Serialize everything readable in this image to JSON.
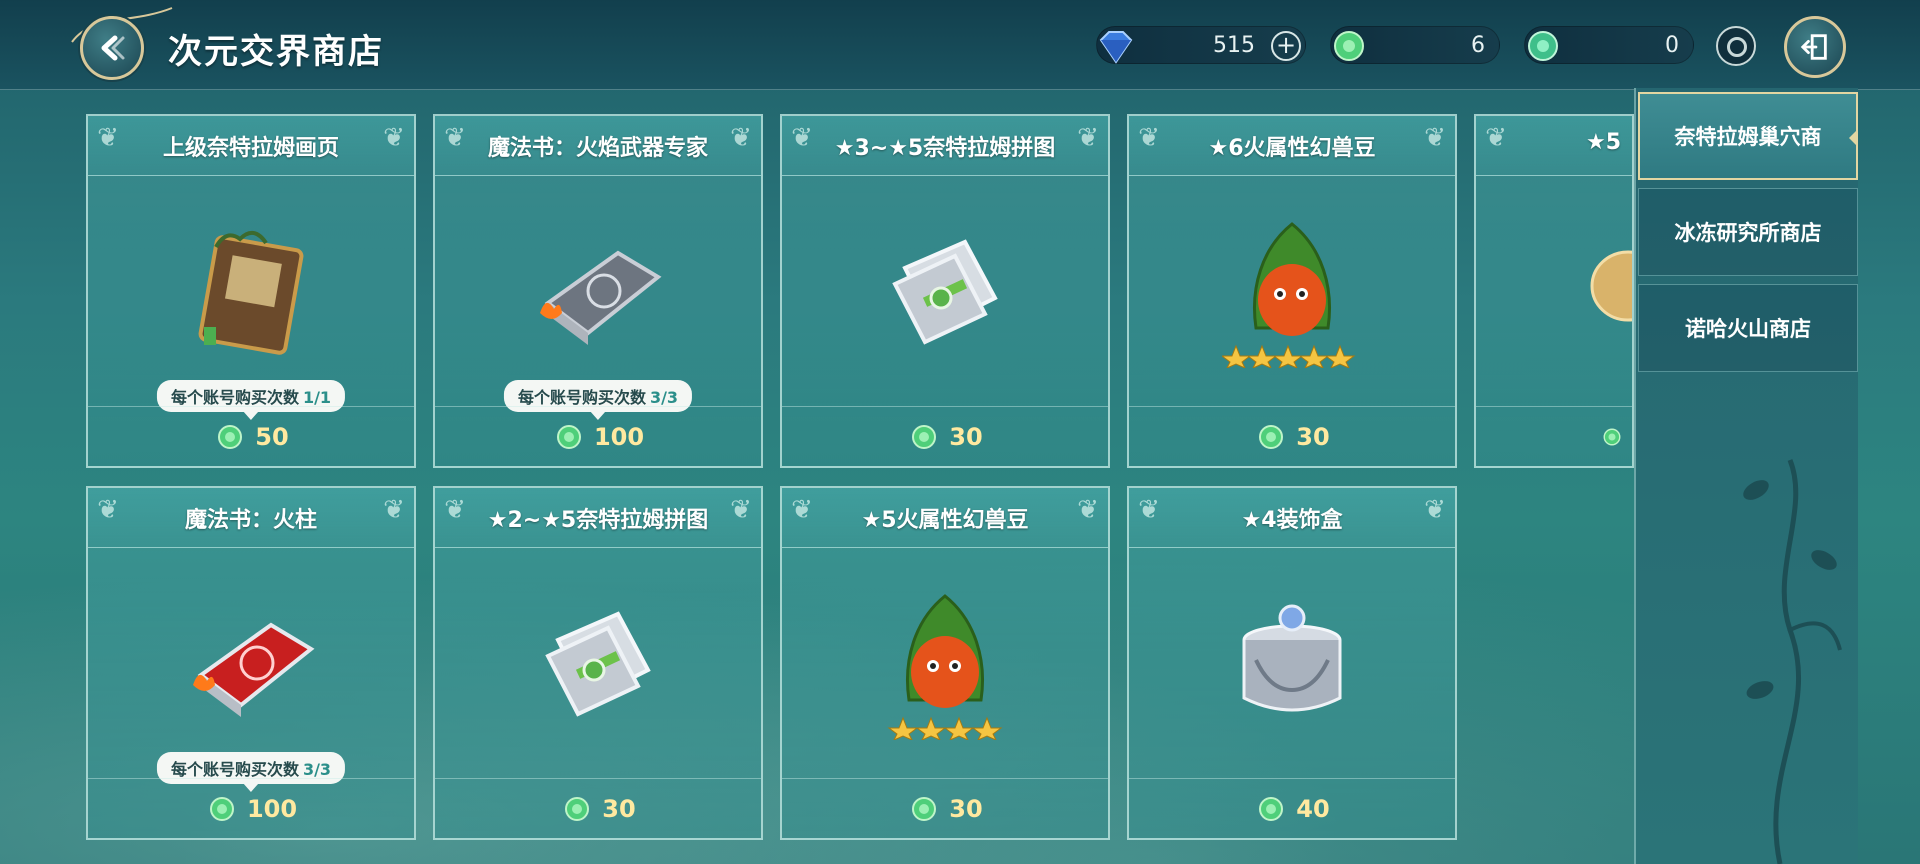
{
  "header": {
    "title": "次元交界商店",
    "resources": [
      {
        "icon": "blue-diamond-icon",
        "value": "515",
        "has_plus": true
      },
      {
        "icon": "green-crystal-icon",
        "value": "6"
      },
      {
        "icon": "green-crystal-icon",
        "value": "0"
      }
    ]
  },
  "shop_items": [
    {
      "name": "上级奈特拉姆画页",
      "price": "50",
      "limit_label": "每个账号购买次数",
      "limit_count": "1/1",
      "art": "brown-book"
    },
    {
      "name": "魔法书：火焰武器专家",
      "price": "100",
      "limit_label": "每个账号购买次数",
      "limit_count": "3/3",
      "art": "gray-book"
    },
    {
      "name": "★3~★5奈特拉姆拼图",
      "price": "30",
      "art": "pack"
    },
    {
      "name": "★6火属性幻兽豆",
      "price": "30",
      "art": "bean6"
    },
    {
      "name": "★5",
      "price": "",
      "art": "partial"
    },
    {
      "name": "魔法书：火柱",
      "price": "100",
      "limit_label": "每个账号购买次数",
      "limit_count": "3/3",
      "art": "red-book"
    },
    {
      "name": "★2~★5奈特拉姆拼图",
      "price": "30",
      "art": "pack"
    },
    {
      "name": "★5火属性幻兽豆",
      "price": "30",
      "art": "bean5"
    },
    {
      "name": "★4装饰盒",
      "price": "40",
      "art": "box"
    }
  ],
  "side_tabs": [
    {
      "label": "奈特拉姆巢穴商",
      "active": true
    },
    {
      "label": "冰冻研究所商店",
      "active": false
    },
    {
      "label": "诺哈火山商店",
      "active": false
    }
  ],
  "colors": {
    "accent_gold": "#e2d6a2",
    "price": "#ffe9a0",
    "card_border": "#c8ebe6"
  }
}
